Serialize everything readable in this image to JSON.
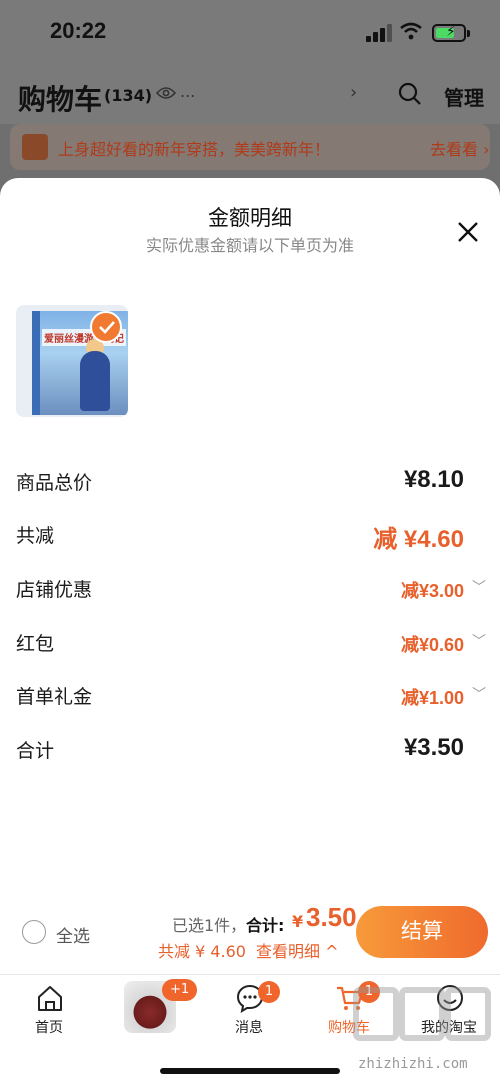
{
  "status_bar": {
    "time": "20:22"
  },
  "cart_header": {
    "title": "购物车",
    "count": "(134)",
    "eye_dots": "...",
    "manage_label": "管理"
  },
  "promo": {
    "text": "上身超好看的新年穿搭，美美跨新年！",
    "link": "去看看 ›"
  },
  "sheet": {
    "title": "金额明细",
    "subtitle": "实际优惠金额请以下单页为准",
    "rows": [
      {
        "label": "商品总价",
        "value": "¥8.10",
        "style": "dark"
      },
      {
        "label": "共减",
        "value": "减 ¥4.60",
        "style": "orange"
      },
      {
        "label": "店铺优惠",
        "value": "减¥3.00",
        "style": "orange-small",
        "expandable": true
      },
      {
        "label": "红包",
        "value": "减¥0.60",
        "style": "orange-small",
        "expandable": true
      },
      {
        "label": "首单礼金",
        "value": "减¥1.00",
        "style": "orange-small",
        "expandable": true
      },
      {
        "label": "合计",
        "value": "¥3.50",
        "style": "dark"
      }
    ],
    "product_cover_title": "爱丽丝漫游奇境记"
  },
  "checkout": {
    "select_all": "全选",
    "selected_info": "已选1件，",
    "sum_label": "合计:",
    "sum_yen": "¥",
    "sum_value": "3.50",
    "discount_line": "共减 ¥ 4.60",
    "detail_link": "查看明细 ^",
    "button_label": "结算"
  },
  "tabbar": {
    "home": "首页",
    "feed_badge": "+1",
    "messages": "消息",
    "messages_badge": "1",
    "cart": "购物车",
    "cart_badge": "1",
    "mine": "我的淘宝"
  },
  "watermark": {
    "text": "zhizhizhi.com"
  },
  "colors": {
    "accent": "#f0652b",
    "discount": "#e8602c"
  }
}
